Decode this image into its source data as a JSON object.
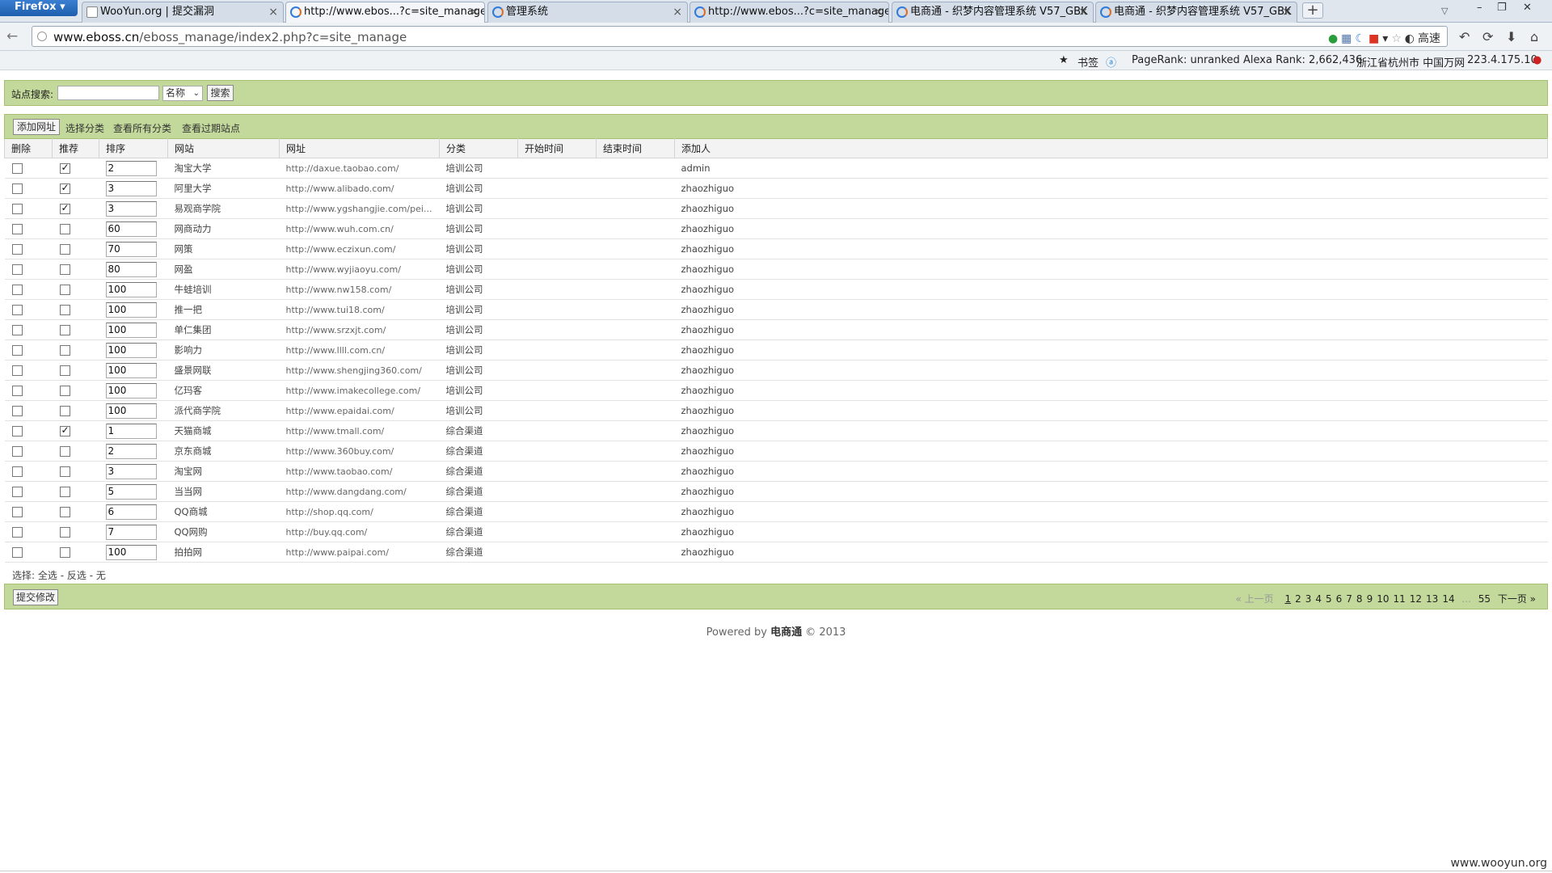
{
  "browser": {
    "menu_button": "Firefox",
    "tabs": [
      {
        "title": "WooYun.org | 提交漏洞",
        "active": false
      },
      {
        "title": "http://www.ebos...?c=site_manage",
        "active": true
      },
      {
        "title": "管理系统",
        "active": false
      },
      {
        "title": "http://www.ebos...?c=site_manage",
        "active": false
      },
      {
        "title": "电商通 - 织梦内容管理系统 V57_GBK",
        "active": false
      },
      {
        "title": "电商通 - 织梦内容管理系统 V57_GBK",
        "active": false
      }
    ],
    "url_domain": "www.eboss.cn",
    "url_path": "/eboss_manage/index2.php?c=site_manage",
    "speed_label": "高速",
    "addon_bar": {
      "bookmarks": "书签",
      "pagerank": "PageRank: unranked",
      "alexa": "Alexa Rank: 2,662,436",
      "location": "浙江省杭州市 中国万网",
      "ip": "223.4.175.10"
    }
  },
  "search": {
    "label": "站点搜索:",
    "input_value": "",
    "select_value": "名称",
    "button": "搜索"
  },
  "actions": {
    "add_url": "添加网址",
    "select_category": "选择分类",
    "view_all_categories": "查看所有分类",
    "view_expired": "查看过期站点"
  },
  "table": {
    "columns": [
      "删除",
      "推荐",
      "排序",
      "网站",
      "网址",
      "分类",
      "开始时间",
      "结束时间",
      "添加人"
    ],
    "rows": [
      {
        "recommended": true,
        "order": "2",
        "site": "淘宝大学",
        "url": "http://daxue.taobao.com/",
        "category": "培训公司",
        "start": "",
        "end": "",
        "adder": "admin"
      },
      {
        "recommended": true,
        "order": "3",
        "site": "阿里大学",
        "url": "http://www.alibado.com/",
        "category": "培训公司",
        "start": "",
        "end": "",
        "adder": "zhaozhiguo"
      },
      {
        "recommended": true,
        "order": "3",
        "site": "易观商学院",
        "url": "http://www.ygshangjie.com/pei...",
        "category": "培训公司",
        "start": "",
        "end": "",
        "adder": "zhaozhiguo"
      },
      {
        "recommended": false,
        "order": "60",
        "site": "网商动力",
        "url": "http://www.wuh.com.cn/",
        "category": "培训公司",
        "start": "",
        "end": "",
        "adder": "zhaozhiguo"
      },
      {
        "recommended": false,
        "order": "70",
        "site": "网策",
        "url": "http://www.eczixun.com/",
        "category": "培训公司",
        "start": "",
        "end": "",
        "adder": "zhaozhiguo"
      },
      {
        "recommended": false,
        "order": "80",
        "site": "网盈",
        "url": "http://www.wyjiaoyu.com/",
        "category": "培训公司",
        "start": "",
        "end": "",
        "adder": "zhaozhiguo"
      },
      {
        "recommended": false,
        "order": "100",
        "site": "牛蛙培训",
        "url": "http://www.nw158.com/",
        "category": "培训公司",
        "start": "",
        "end": "",
        "adder": "zhaozhiguo"
      },
      {
        "recommended": false,
        "order": "100",
        "site": "推一把",
        "url": "http://www.tui18.com/",
        "category": "培训公司",
        "start": "",
        "end": "",
        "adder": "zhaozhiguo"
      },
      {
        "recommended": false,
        "order": "100",
        "site": "单仁集团",
        "url": "http://www.srzxjt.com/",
        "category": "培训公司",
        "start": "",
        "end": "",
        "adder": "zhaozhiguo"
      },
      {
        "recommended": false,
        "order": "100",
        "site": "影响力",
        "url": "http://www.llll.com.cn/",
        "category": "培训公司",
        "start": "",
        "end": "",
        "adder": "zhaozhiguo"
      },
      {
        "recommended": false,
        "order": "100",
        "site": "盛景网联",
        "url": "http://www.shengjing360.com/",
        "category": "培训公司",
        "start": "",
        "end": "",
        "adder": "zhaozhiguo"
      },
      {
        "recommended": false,
        "order": "100",
        "site": "亿玛客",
        "url": "http://www.imakecollege.com/",
        "category": "培训公司",
        "start": "",
        "end": "",
        "adder": "zhaozhiguo"
      },
      {
        "recommended": false,
        "order": "100",
        "site": "派代商学院",
        "url": "http://www.epaidai.com/",
        "category": "培训公司",
        "start": "",
        "end": "",
        "adder": "zhaozhiguo"
      },
      {
        "recommended": true,
        "order": "1",
        "site": "天猫商城",
        "url": "http://www.tmall.com/",
        "category": "综合渠道",
        "start": "",
        "end": "",
        "adder": "zhaozhiguo"
      },
      {
        "recommended": false,
        "order": "2",
        "site": "京东商城",
        "url": "http://www.360buy.com/",
        "category": "综合渠道",
        "start": "",
        "end": "",
        "adder": "zhaozhiguo"
      },
      {
        "recommended": false,
        "order": "3",
        "site": "淘宝网",
        "url": "http://www.taobao.com/",
        "category": "综合渠道",
        "start": "",
        "end": "",
        "adder": "zhaozhiguo"
      },
      {
        "recommended": false,
        "order": "5",
        "site": "当当网",
        "url": "http://www.dangdang.com/",
        "category": "综合渠道",
        "start": "",
        "end": "",
        "adder": "zhaozhiguo"
      },
      {
        "recommended": false,
        "order": "6",
        "site": "QQ商城",
        "url": "http://shop.qq.com/",
        "category": "综合渠道",
        "start": "",
        "end": "",
        "adder": "zhaozhiguo"
      },
      {
        "recommended": false,
        "order": "7",
        "site": "QQ网购",
        "url": "http://buy.qq.com/",
        "category": "综合渠道",
        "start": "",
        "end": "",
        "adder": "zhaozhiguo"
      },
      {
        "recommended": false,
        "order": "100",
        "site": "拍拍网",
        "url": "http://www.paipai.com/",
        "category": "综合渠道",
        "start": "",
        "end": "",
        "adder": "zhaozhiguo"
      }
    ]
  },
  "selection": {
    "prefix": "选择:",
    "all": "全选",
    "invert": "反选",
    "none": "无",
    "separator": "-"
  },
  "bottom": {
    "submit": "提交修改",
    "pager": {
      "prev": "« 上一页",
      "pages": [
        "1",
        "2",
        "3",
        "4",
        "5",
        "6",
        "7",
        "8",
        "9",
        "10",
        "11",
        "12",
        "13",
        "14"
      ],
      "current": "1",
      "ellipsis": "...",
      "last": "55",
      "next": "下一页 »"
    }
  },
  "footer": {
    "powered_by": "Powered by",
    "brand": "电商通",
    "copyright": "© 2013"
  },
  "watermark": "www.wooyun.org"
}
